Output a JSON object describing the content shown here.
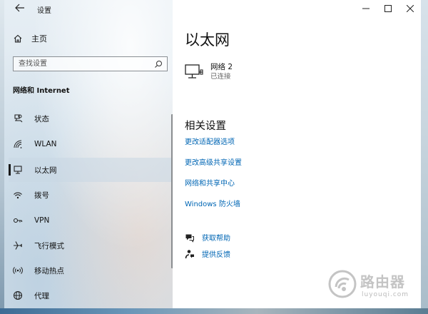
{
  "window": {
    "app_title": "设置",
    "controls": [
      "minimize",
      "maximize",
      "close"
    ]
  },
  "sidebar": {
    "home_label": "主页",
    "search_placeholder": "查找设置",
    "section_title": "网络和 Internet",
    "items": [
      {
        "label": "状态",
        "icon": "status-icon"
      },
      {
        "label": "WLAN",
        "icon": "wifi-icon"
      },
      {
        "label": "以太网",
        "icon": "ethernet-icon",
        "active": true
      },
      {
        "label": "拨号",
        "icon": "dialup-icon"
      },
      {
        "label": "VPN",
        "icon": "vpn-icon"
      },
      {
        "label": "飞行模式",
        "icon": "airplane-icon"
      },
      {
        "label": "移动热点",
        "icon": "hotspot-icon"
      },
      {
        "label": "代理",
        "icon": "globe-icon"
      }
    ]
  },
  "main": {
    "title": "以太网",
    "network": {
      "name": "网络 2",
      "status": "已连接"
    },
    "related_title": "相关设置",
    "links": [
      "更改适配器选项",
      "更改高级共享设置",
      "网络和共享中心",
      "Windows 防火墙"
    ],
    "help": {
      "get_help": "获取帮助",
      "feedback": "提供反馈"
    }
  },
  "watermark": {
    "text_cn": "路由器",
    "text_en": "luyouqi.com"
  },
  "colors": {
    "accent": "#0066b4",
    "content_bg": "#ffffff"
  }
}
